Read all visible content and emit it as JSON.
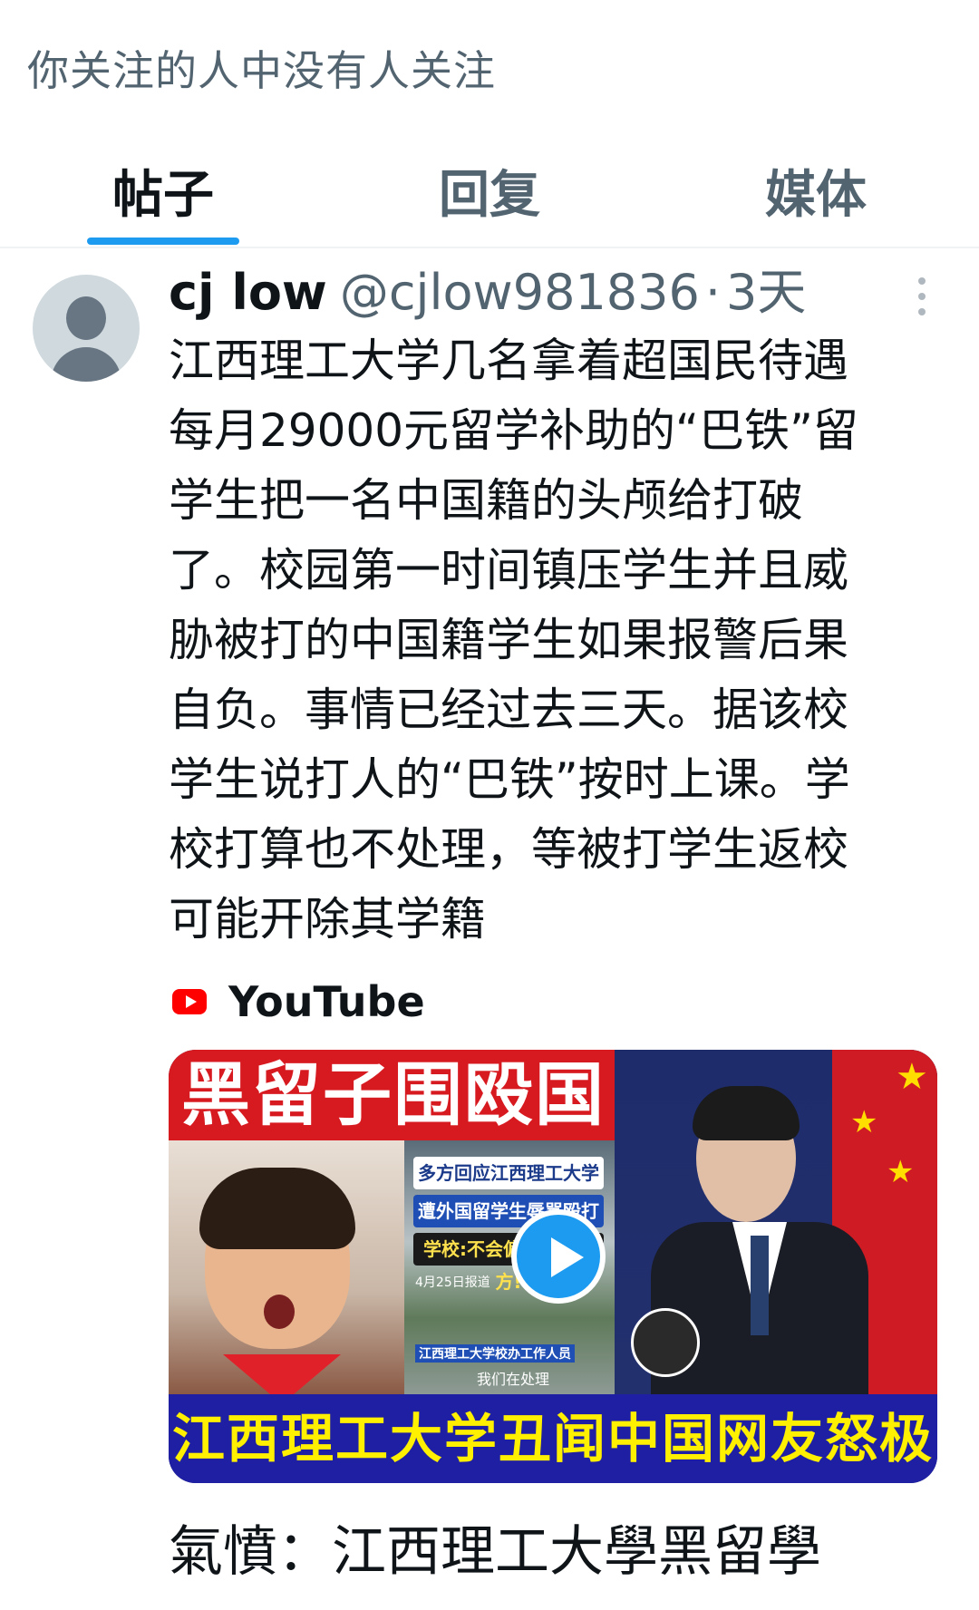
{
  "header": {
    "follow_note": "你关注的人中没有人关注"
  },
  "tabs": [
    {
      "label": "帖子",
      "active": true
    },
    {
      "label": "回复",
      "active": false
    },
    {
      "label": "媒体",
      "active": false
    }
  ],
  "colors": {
    "accent": "#1d9bf0",
    "text_primary": "#0f1419",
    "text_secondary": "#536471",
    "youtube_red": "#ff0000"
  },
  "post": {
    "author_name": "cj low",
    "author_handle": "@cjlow981836",
    "separator": "·",
    "time": "3天",
    "more_icon": "more-vertical-icon",
    "text": "江西理工大学几名拿着超国民待遇\n每月29000元留学补助的“巴铁”留\n学生把一名中国籍的头颅给打破\n了。校园第一时间镇压学生并且威\n胁被打的中国籍学生如果报警后果\n自负。事情已经过去三天。据该校\n学生说打人的“巴铁”按时上课。学\n校打算也不处理，等被打学生返校\n可能开除其学籍"
  },
  "link_card": {
    "source_icon": "youtube-icon",
    "source_label": "YouTube",
    "thumbnail": {
      "banner_text": "黑留子围殴国人",
      "mid_line1": "多方回应江西理工大学学生",
      "mid_line2": "遭外国留学生辱骂殴打",
      "mid_line3": "学校:不会偏袒任何一方!",
      "mid_date": "4月25日报道",
      "mid_caption1": "江西理工大学校办工作人员",
      "mid_caption2": "我们在处理",
      "bottom_text": "江西理工大学丑闻中国网友怒极",
      "play_icon": "play-icon"
    },
    "title": "氣憤：江西理工大學黑留學"
  }
}
